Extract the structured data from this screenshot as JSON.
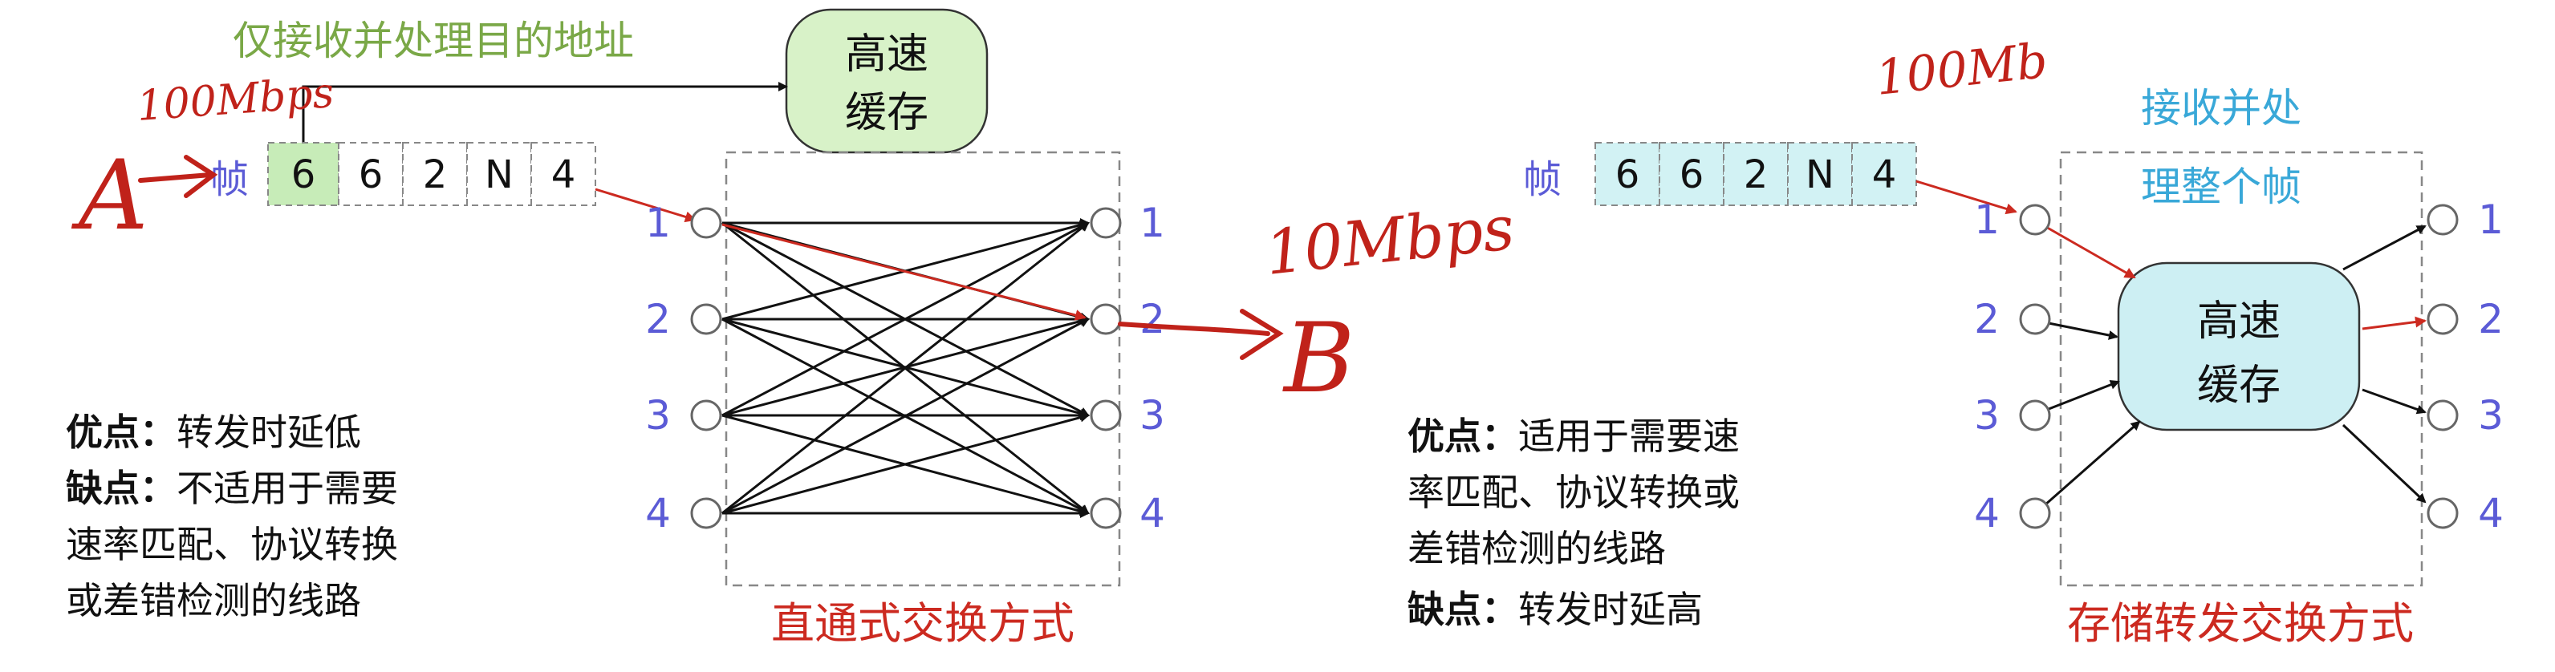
{
  "colors": {
    "port_label": "#5b5bd6",
    "cache_green_fill": "#d8f2c8",
    "cache_blue_fill": "#cdeff3",
    "frame_highlight": "#c7ecb8",
    "frame_blue_fill": "#d2f2f4",
    "red": "#cc2a20",
    "annotation_green": "#7aa847",
    "annotation_blue": "#39a8d8",
    "black": "#111111"
  },
  "left": {
    "annotation": "仅接收并处理目的地址",
    "cache_line1": "高速",
    "cache_line2": "缓存",
    "frame_label": "帧",
    "frame_fields": [
      "6",
      "6",
      "2",
      "N",
      "4"
    ],
    "ports_in": [
      "1",
      "2",
      "3",
      "4"
    ],
    "ports_out": [
      "1",
      "2",
      "3",
      "4"
    ],
    "caption": "直通式交换方式",
    "pros_label": "优点：",
    "pros_text": "转发时延低",
    "cons_label": "缺点：",
    "cons_line1": "不适用于需要",
    "cons_line2": "速率匹配、协议转换",
    "cons_line3": "或差错检测的线路"
  },
  "right": {
    "annotation_line1": "接收并处",
    "annotation_line2": "理整个帧",
    "cache_line1": "高速",
    "cache_line2": "缓存",
    "frame_label": "帧",
    "frame_fields": [
      "6",
      "6",
      "2",
      "N",
      "4"
    ],
    "ports_in": [
      "1",
      "2",
      "3",
      "4"
    ],
    "ports_out": [
      "1",
      "2",
      "3",
      "4"
    ],
    "caption": "存储转发交换方式",
    "pros_label": "优点：",
    "pros_line1": "适用于需要速",
    "pros_line2": "率匹配、协议转换或",
    "pros_line3": "差错检测的线路",
    "cons_label": "缺点：",
    "cons_text": "转发时延高"
  },
  "handwriting": {
    "rate_left": "100Mbps",
    "rate_mid": "10Mbps",
    "rate_right": "100Mb",
    "node_a": "A",
    "node_b": "B"
  }
}
